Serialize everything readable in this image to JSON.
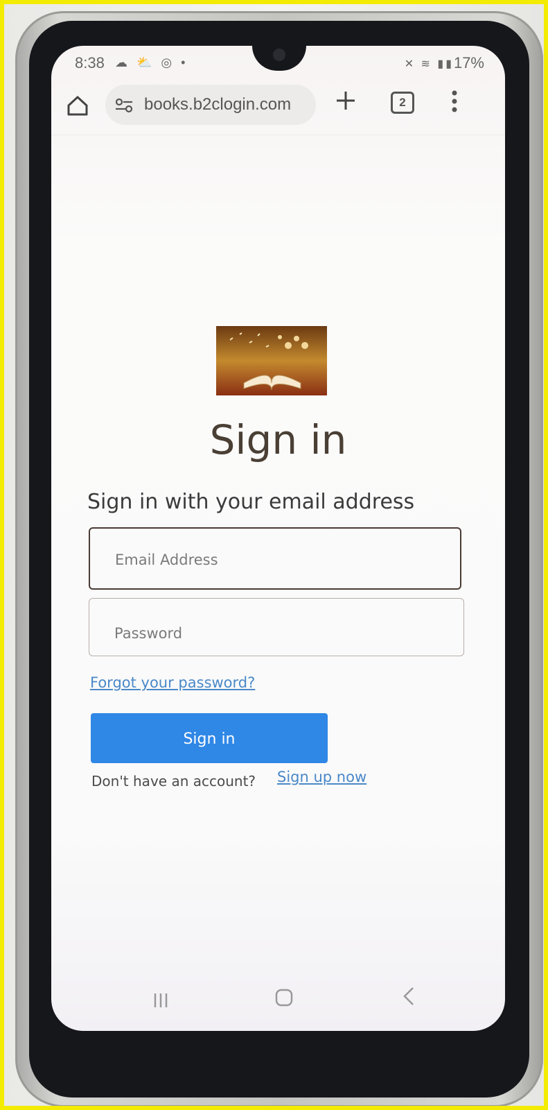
{
  "status_bar": {
    "time": "8:38",
    "battery": "17%"
  },
  "browser": {
    "url": "books.b2clogin.com",
    "tab_count": "2"
  },
  "login": {
    "title": "Sign in",
    "intro": "Sign in with your email address",
    "email_placeholder": "Email Address",
    "password_placeholder": "Password",
    "forgot_password": "Forgot your password?",
    "sign_in_button": "Sign in",
    "no_account": "Don't have an account?",
    "sign_up": "Sign up now"
  },
  "colors": {
    "primary_button": "#2f87e6",
    "link": "#4a88c8",
    "title": "#4a3f34"
  },
  "icons": {
    "home": "house-icon",
    "site_settings": "site-settings-icon",
    "new_tab": "plus-icon",
    "tabs": "tab-switcher-icon",
    "menu": "vertical-dots-icon",
    "nav_recents": "recents-icon",
    "nav_home": "home-square-icon",
    "nav_back": "back-chevron-icon"
  }
}
